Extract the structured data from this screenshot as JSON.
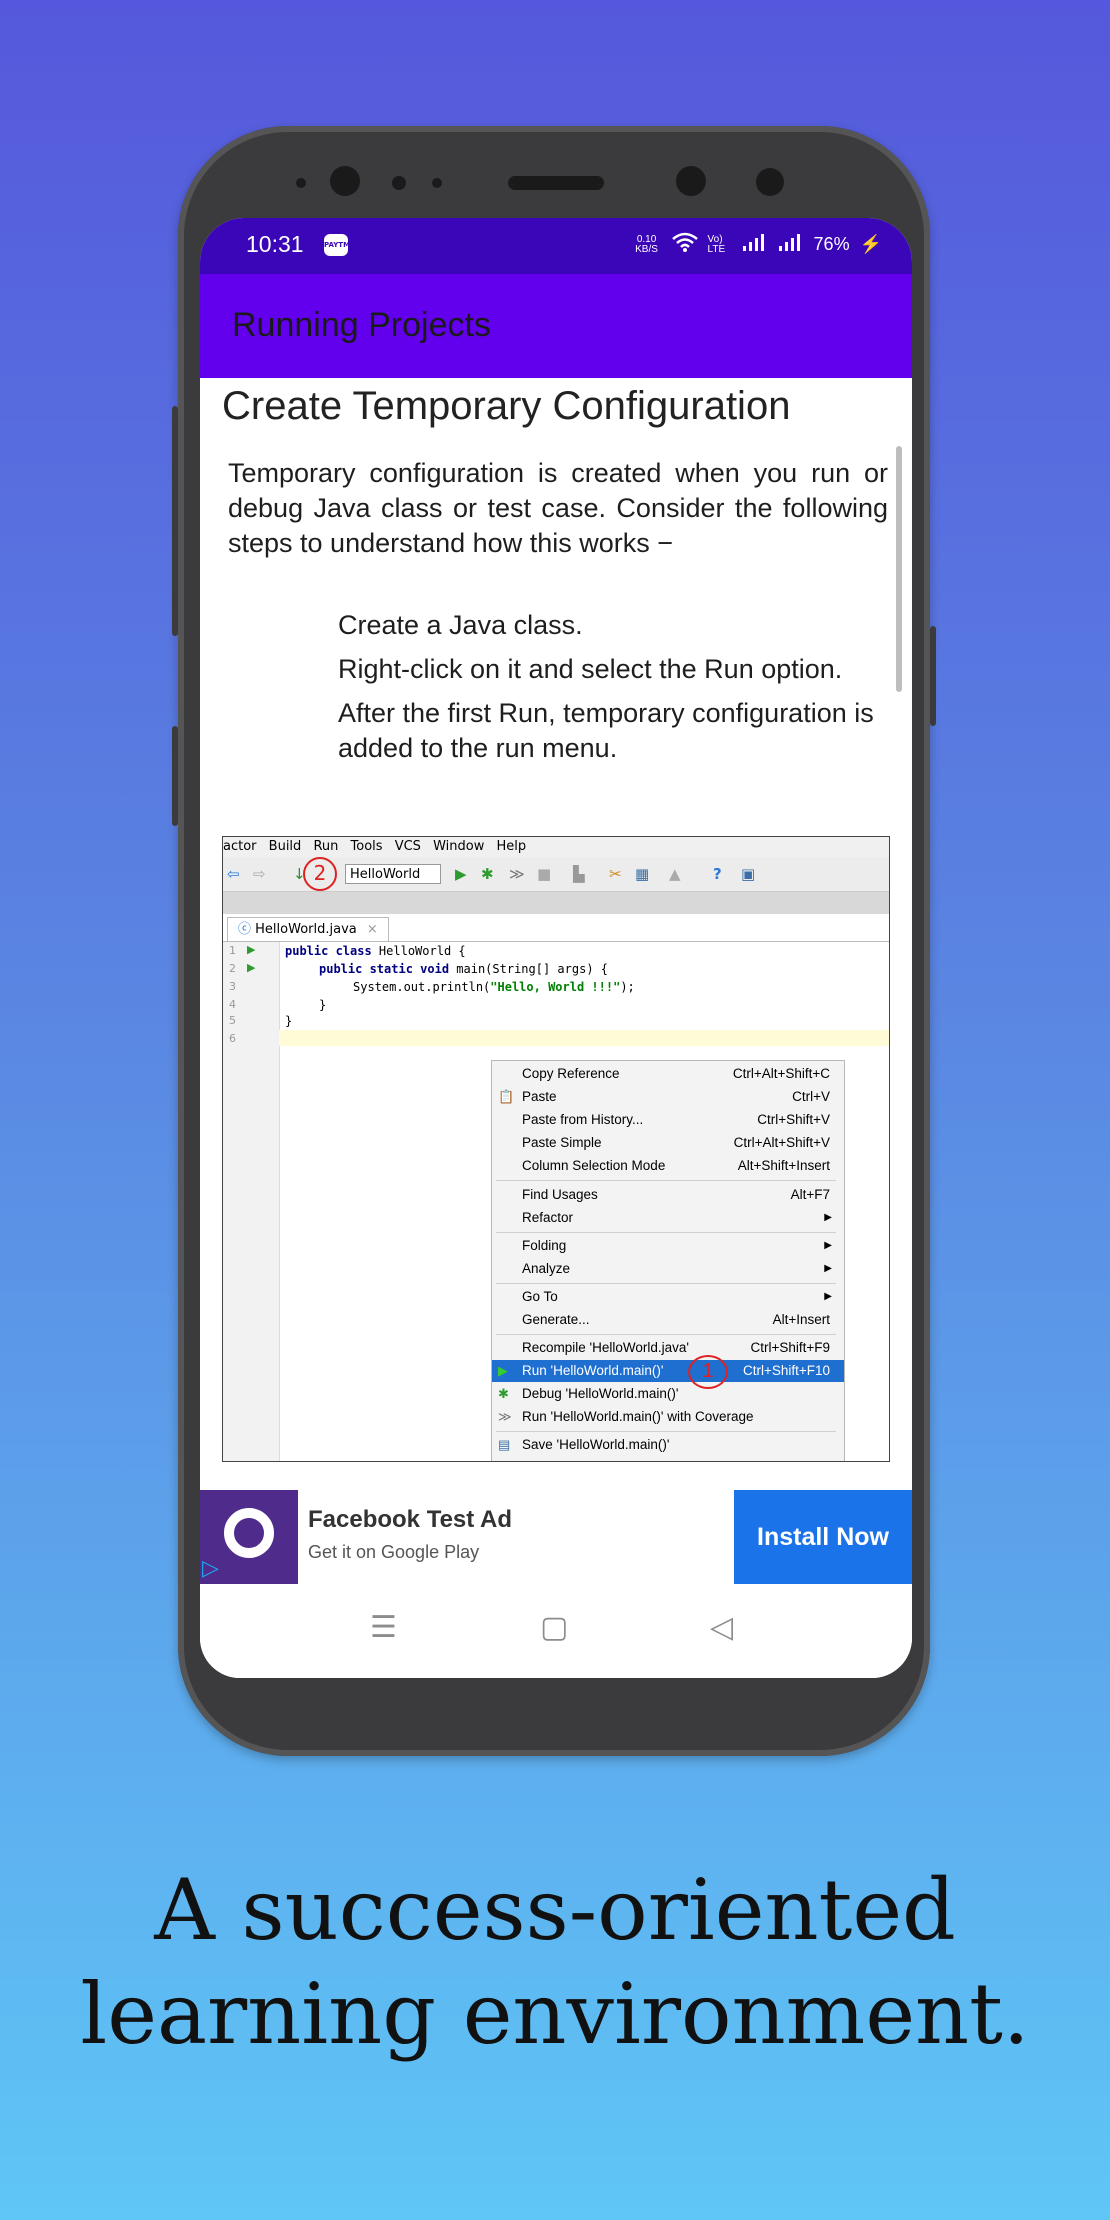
{
  "status_bar": {
    "time": "10:31",
    "app_badge": "PAYTM",
    "net_speed": "0.10 KB/S",
    "volte": "Vo) LTE",
    "battery": "76%"
  },
  "app_bar": {
    "title": "Running Projects"
  },
  "article": {
    "heading": "Create Temporary Configuration",
    "paragraph": "Temporary configuration is created when you run or debug Java class or test case. Consider the following steps to understand how this works −",
    "steps": [
      "Create a Java class.",
      "Right-click on it and select the Run option.",
      "After the first Run, temporary configuration is added to the run menu."
    ]
  },
  "ide_screenshot": {
    "menu": [
      "actor",
      "Build",
      "Run",
      "Tools",
      "VCS",
      "Window",
      "Help"
    ],
    "run_config": "HelloWorld",
    "marker_2": "2",
    "marker_1": "1",
    "tab": "HelloWorld.java",
    "line_numbers": [
      "1",
      "2",
      "3",
      "4",
      "5",
      "6"
    ],
    "code": {
      "l1_kw": "public class",
      "l1_rest": " HelloWorld {",
      "l2_kw": "public static void",
      "l2_rest": " main(String[] args) {",
      "l3_pre": "System.out.println(",
      "l3_str": "\"Hello, World !!!\"",
      "l3_post": ");",
      "l4": "}",
      "l5": "}"
    },
    "context_menu": [
      {
        "label": "Copy Reference",
        "shortcut": "Ctrl+Alt+Shift+C"
      },
      {
        "label": "Paste",
        "shortcut": "Ctrl+V"
      },
      {
        "label": "Paste from History...",
        "shortcut": "Ctrl+Shift+V"
      },
      {
        "label": "Paste Simple",
        "shortcut": "Ctrl+Alt+Shift+V"
      },
      {
        "label": "Column Selection Mode",
        "shortcut": "Alt+Shift+Insert"
      },
      {
        "label": "Find Usages",
        "shortcut": "Alt+F7"
      },
      {
        "label": "Refactor",
        "shortcut": ""
      },
      {
        "label": "Folding",
        "shortcut": ""
      },
      {
        "label": "Analyze",
        "shortcut": ""
      },
      {
        "label": "Go To",
        "shortcut": ""
      },
      {
        "label": "Generate...",
        "shortcut": "Alt+Insert"
      },
      {
        "label": "Recompile 'HelloWorld.java'",
        "shortcut": "Ctrl+Shift+F9"
      },
      {
        "label": "Run 'HelloWorld.main()'",
        "shortcut": "Ctrl+Shift+F10"
      },
      {
        "label": "Debug 'HelloWorld.main()'",
        "shortcut": ""
      },
      {
        "label": "Run 'HelloWorld.main()' with Coverage",
        "shortcut": ""
      },
      {
        "label": "Save 'HelloWorld.main()'",
        "shortcut": ""
      }
    ]
  },
  "ad": {
    "title": "Facebook Test Ad",
    "subtitle": "Get it on Google Play",
    "cta": "Install Now"
  },
  "tagline": {
    "line1": "A success-oriented",
    "line2": "learning environment."
  },
  "colors": {
    "app_bar": "#6200ee",
    "status_bar": "#3a06b7",
    "install_button": "#1a73e8",
    "menu_highlight": "#1f6fd1"
  }
}
